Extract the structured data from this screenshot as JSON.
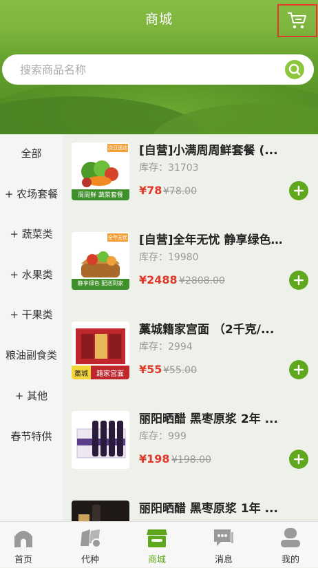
{
  "header": {
    "title": "商城",
    "search_placeholder": "搜索商品名称"
  },
  "sidebar": {
    "categories": [
      {
        "label": "全部"
      },
      {
        "label": "+ 农场套餐"
      },
      {
        "label": "+ 蔬菜类"
      },
      {
        "label": "+ 水果类"
      },
      {
        "label": "+ 干果类"
      },
      {
        "label": "粮油副食类"
      },
      {
        "label": "+ 其他"
      },
      {
        "label": "春节特供"
      }
    ]
  },
  "products": [
    {
      "name": "[自营]小满周周鲜套餐 (...",
      "stock": "库存：31703",
      "price": "¥78",
      "old_price": "¥78.00",
      "thumb_banner": "周周鲜 蔬菜套餐",
      "thumb_tag": "次日送达"
    },
    {
      "name": "[自营]全年无忧 静享绿色...",
      "stock": "库存：19980",
      "price": "¥2488",
      "old_price": "¥2808.00",
      "thumb_banner": "静享绿色 配送到家",
      "thumb_tag": "全年无忧"
    },
    {
      "name": "藁城籍家宫面 （2千克/...",
      "stock": "库存：2994",
      "price": "¥55",
      "old_price": "¥55.00",
      "thumb_banner_left": "藁城",
      "thumb_banner_right": "籍家宫面"
    },
    {
      "name": "丽阳晒醋 黑枣原浆 2年 ...",
      "stock": "库存：999",
      "price": "¥198",
      "old_price": "¥198.00"
    },
    {
      "name": "丽阳晒醋 黑枣原浆 1年 ...",
      "stock": "",
      "price": "",
      "old_price": ""
    }
  ],
  "tabbar": {
    "items": [
      {
        "label": "首页",
        "icon": "home-icon"
      },
      {
        "label": "代种",
        "icon": "plant-icon"
      },
      {
        "label": "商城",
        "icon": "shop-icon"
      },
      {
        "label": "消息",
        "icon": "message-icon"
      },
      {
        "label": "我的",
        "icon": "profile-icon"
      }
    ],
    "active_index": 2
  },
  "colors": {
    "accent_green": "#5fa81d",
    "price_red": "#e0392b",
    "highlight_border": "#e0392b"
  }
}
